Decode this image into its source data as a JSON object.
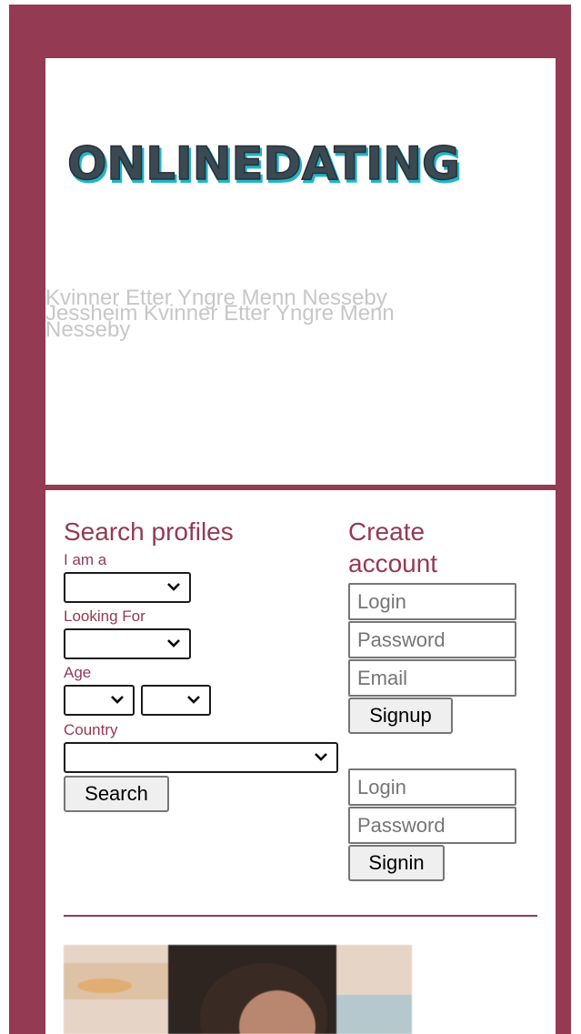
{
  "colors": {
    "brand": "#943a53",
    "panel": "#ffffff",
    "tagline": "#c7c7c7"
  },
  "logo": {
    "text": "ONLINEDATING"
  },
  "tagline": {
    "line1": "Kvinner Etter Yngre Menn Nesseby",
    "line2": "Jessheim Kvinner Etter Yngre Menn",
    "line3": "Nesseby"
  },
  "search": {
    "title": "Search profiles",
    "i_am_label": "I am a",
    "i_am_value": "",
    "looking_for_label": "Looking For",
    "looking_for_value": "",
    "age_label": "Age",
    "age_from_value": "",
    "age_to_value": "",
    "country_label": "Country",
    "country_value": "",
    "search_button": "Search"
  },
  "create_account": {
    "title_line1": "Create",
    "title_line2": "account",
    "login_placeholder": "Login",
    "password_placeholder": "Password",
    "email_placeholder": "Email",
    "signup_button": "Signup"
  },
  "signin": {
    "login_placeholder": "Login",
    "password_placeholder": "Password",
    "signin_button": "Signin"
  },
  "icons": {
    "dropdown": "chevron-down-icon"
  }
}
